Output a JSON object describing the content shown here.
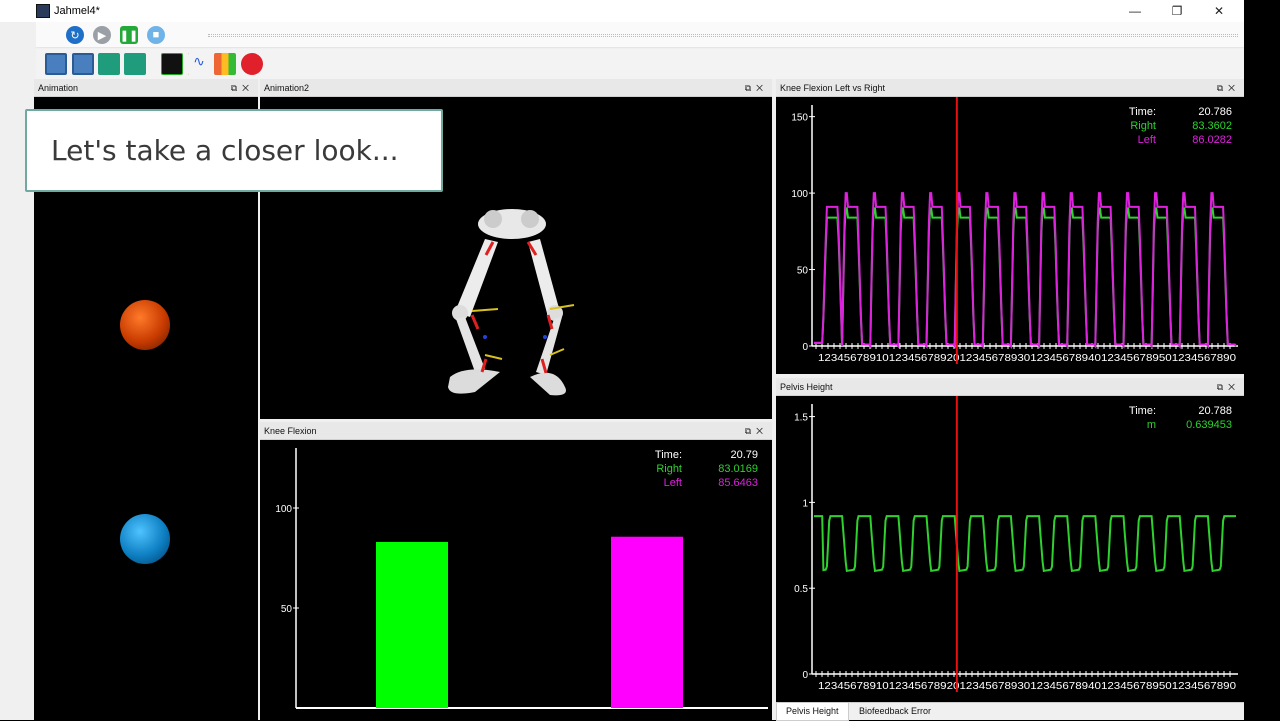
{
  "window": {
    "title": "Jahmel4*",
    "min_glyph": "—",
    "max_glyph": "❐",
    "close_glyph": "✕"
  },
  "toolbar": {
    "icons": [
      "restart-icon",
      "play-icon",
      "pause-icon",
      "stop-icon",
      "save-as-icon",
      "save-icon",
      "waveform-icon",
      "waveform-add-icon",
      "plot-icon",
      "audio-icon",
      "bars-icon",
      "record-icon"
    ],
    "seek_position": 0.36
  },
  "panels": {
    "animation": {
      "title": "Animation"
    },
    "animation2": {
      "title": "Animation2"
    },
    "knee_lr": {
      "title": "Knee Flexion Left vs Right"
    },
    "knee_flexion": {
      "title": "Knee Flexion"
    },
    "pelvis": {
      "title": "Pelvis Height"
    }
  },
  "overlay": {
    "text": "Let's take a closer look..."
  },
  "balls": {
    "top_color": "#e8500a",
    "bottom_color": "#1a9ad8"
  },
  "knee_flexion_readout": {
    "time_label": "Time:",
    "time": "20.79",
    "right_label": "Right",
    "right": "83.0169",
    "left_label": "Left",
    "left": "85.6463"
  },
  "knee_lr_readout": {
    "time_label": "Time:",
    "time": "20.786",
    "right_label": "Right",
    "right": "83.3602",
    "left_label": "Left",
    "left": "86.0282"
  },
  "pelvis_readout": {
    "time_label": "Time:",
    "time": "20.788",
    "m_label": "m",
    "m": "0.639453"
  },
  "tabs": {
    "pelvis": "Pelvis Height",
    "biofeedback": "Biofeedback Error"
  },
  "colors": {
    "right": "#2ed12e",
    "left": "#dd22dd",
    "cursor": "#e81010"
  },
  "chart_data": [
    {
      "type": "line",
      "title": "Knee Flexion Left vs Right",
      "ylim": [
        0,
        155
      ],
      "yticks": [
        0,
        50,
        100,
        150
      ],
      "cursor_x": 0.34,
      "cycles": 15,
      "series": [
        {
          "name": "Right",
          "peak": 90,
          "base": 0
        },
        {
          "name": "Left",
          "peak": 97,
          "base": 0
        }
      ],
      "xtick_text": "12345678910123456789201234567893012345678940123456789501234567890"
    },
    {
      "type": "bar",
      "title": "Knee Flexion",
      "categories": [
        "Right",
        "Left"
      ],
      "values": [
        83.0169,
        85.6463
      ],
      "ylim": [
        0,
        130
      ],
      "yticks": [
        50,
        100
      ]
    },
    {
      "type": "line",
      "title": "Pelvis Height",
      "ylim": [
        0,
        1.55
      ],
      "yticks": [
        0,
        0.5,
        1,
        1.5
      ],
      "cursor_x": 0.34,
      "cycles": 15,
      "series": [
        {
          "name": "m",
          "high": 0.92,
          "low": 0.6
        }
      ],
      "xtick_text": "12345678910123456789201234567893012345678940123456789501234567890"
    }
  ]
}
